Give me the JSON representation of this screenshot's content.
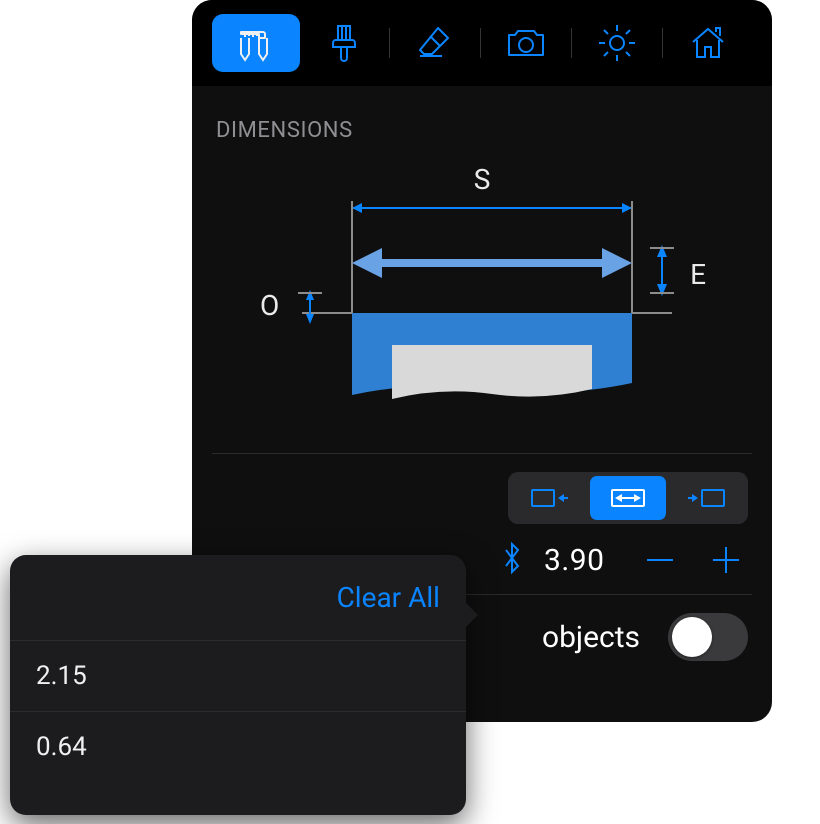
{
  "toolbar": {
    "items": [
      {
        "name": "measure-tool",
        "active": true
      },
      {
        "name": "brush-tool",
        "active": false
      },
      {
        "name": "eraser-tool",
        "active": false
      },
      {
        "name": "camera-tool",
        "active": false
      },
      {
        "name": "brightness-tool",
        "active": false
      },
      {
        "name": "home-tool",
        "active": false
      }
    ]
  },
  "section": {
    "title": "DIMENSIONS"
  },
  "diagram": {
    "labels": {
      "span": "S",
      "offset": "O",
      "extension": "E"
    }
  },
  "align": {
    "options": [
      "snap-left",
      "snap-both",
      "snap-right"
    ],
    "selected": 1
  },
  "stepper": {
    "icon": "bluetooth-icon",
    "value": "3.90"
  },
  "toggle": {
    "label": "objects",
    "on": false
  },
  "popover": {
    "clear_label": "Clear All",
    "items": [
      "2.15",
      "0.64"
    ]
  },
  "colors": {
    "accent": "#0a84ff",
    "panel_bg": "#0f0f0f",
    "toolbar_bg": "#000000",
    "popover_bg": "#1c1c1e"
  }
}
